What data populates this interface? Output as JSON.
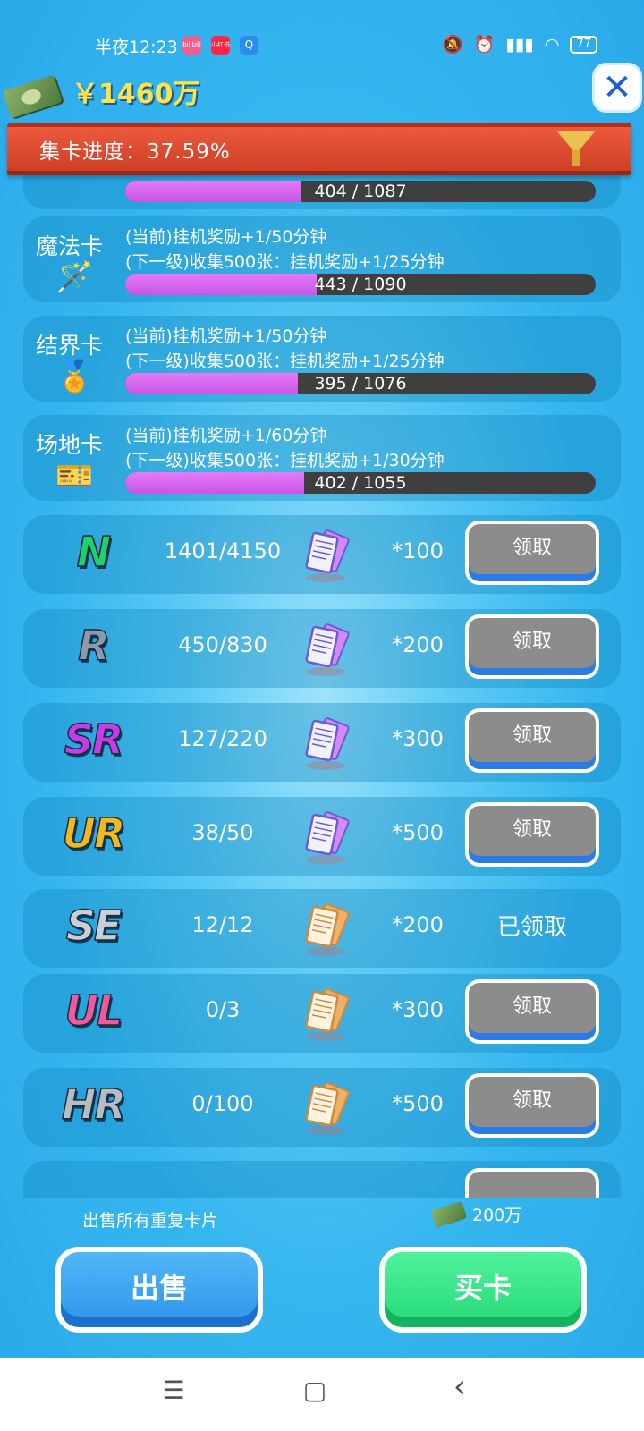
{
  "status_bar": {
    "time": "半夜12:23",
    "apps": [
      "bilibili",
      "小红书",
      "Q"
    ],
    "battery": "77"
  },
  "header": {
    "money": "￥1460万",
    "close_icon": "close-icon"
  },
  "banner": {
    "title": "集卡进度：37.59%",
    "filter_icon": "funnel-icon"
  },
  "cards_partial": {
    "progress_text": "404 / 1087",
    "progress": 0.372
  },
  "cards": [
    {
      "name": "魔法卡",
      "icon": "magic-card-icon",
      "glyph": "🪄",
      "current": "(当前)挂机奖励+1/50分钟",
      "next": "(下一级)收集500张：挂机奖励+1/25分钟",
      "progress_text": "443 / 1090",
      "progress": 0.406
    },
    {
      "name": "结界卡",
      "icon": "barrier-card-icon",
      "glyph": "🏅",
      "current": "(当前)挂机奖励+1/50分钟",
      "next": "(下一级)收集500张：挂机奖励+1/25分钟",
      "progress_text": "395 / 1076",
      "progress": 0.367
    },
    {
      "name": "场地卡",
      "icon": "field-card-icon",
      "glyph": "🎫",
      "current": "(当前)挂机奖励+1/60分钟",
      "next": "(下一级)收集500张：挂机奖励+1/30分钟",
      "progress_text": "402 / 1055",
      "progress": 0.381
    }
  ],
  "rarity_rows": [
    {
      "rarity": "N",
      "count": "1401/4150",
      "reward": "*100",
      "button": "领取",
      "color": "#1fd16a",
      "ticket": "blue"
    },
    {
      "rarity": "R",
      "count": "450/830",
      "reward": "*200",
      "button": "领取",
      "color": "#8a9aa8",
      "ticket": "blue"
    },
    {
      "rarity": "SR",
      "count": "127/220",
      "reward": "*300",
      "button": "领取",
      "color": "#c93be8",
      "ticket": "blue"
    },
    {
      "rarity": "UR",
      "count": "38/50",
      "reward": "*500",
      "button": "领取",
      "color": "#f2b81c",
      "ticket": "blue"
    },
    {
      "rarity": "SE",
      "count": "12/12",
      "reward": "*200",
      "button": "已领取",
      "color": "#c9cfd4",
      "ticket": "orange"
    },
    {
      "rarity": "UL",
      "count": "0/3",
      "reward": "*300",
      "button": "领取",
      "color": "#f05a9c",
      "ticket": "orange"
    },
    {
      "rarity": "HR",
      "count": "0/100",
      "reward": "*500",
      "button": "领取",
      "color": "#b5bcc4",
      "ticket": "orange"
    }
  ],
  "bottom": {
    "sell_hint": "出售所有重复卡片",
    "price": "200万",
    "sell_label": "出售",
    "buy_label": "买卡"
  },
  "nav": {
    "menu": "☰",
    "home": "▢",
    "back": "‹"
  }
}
